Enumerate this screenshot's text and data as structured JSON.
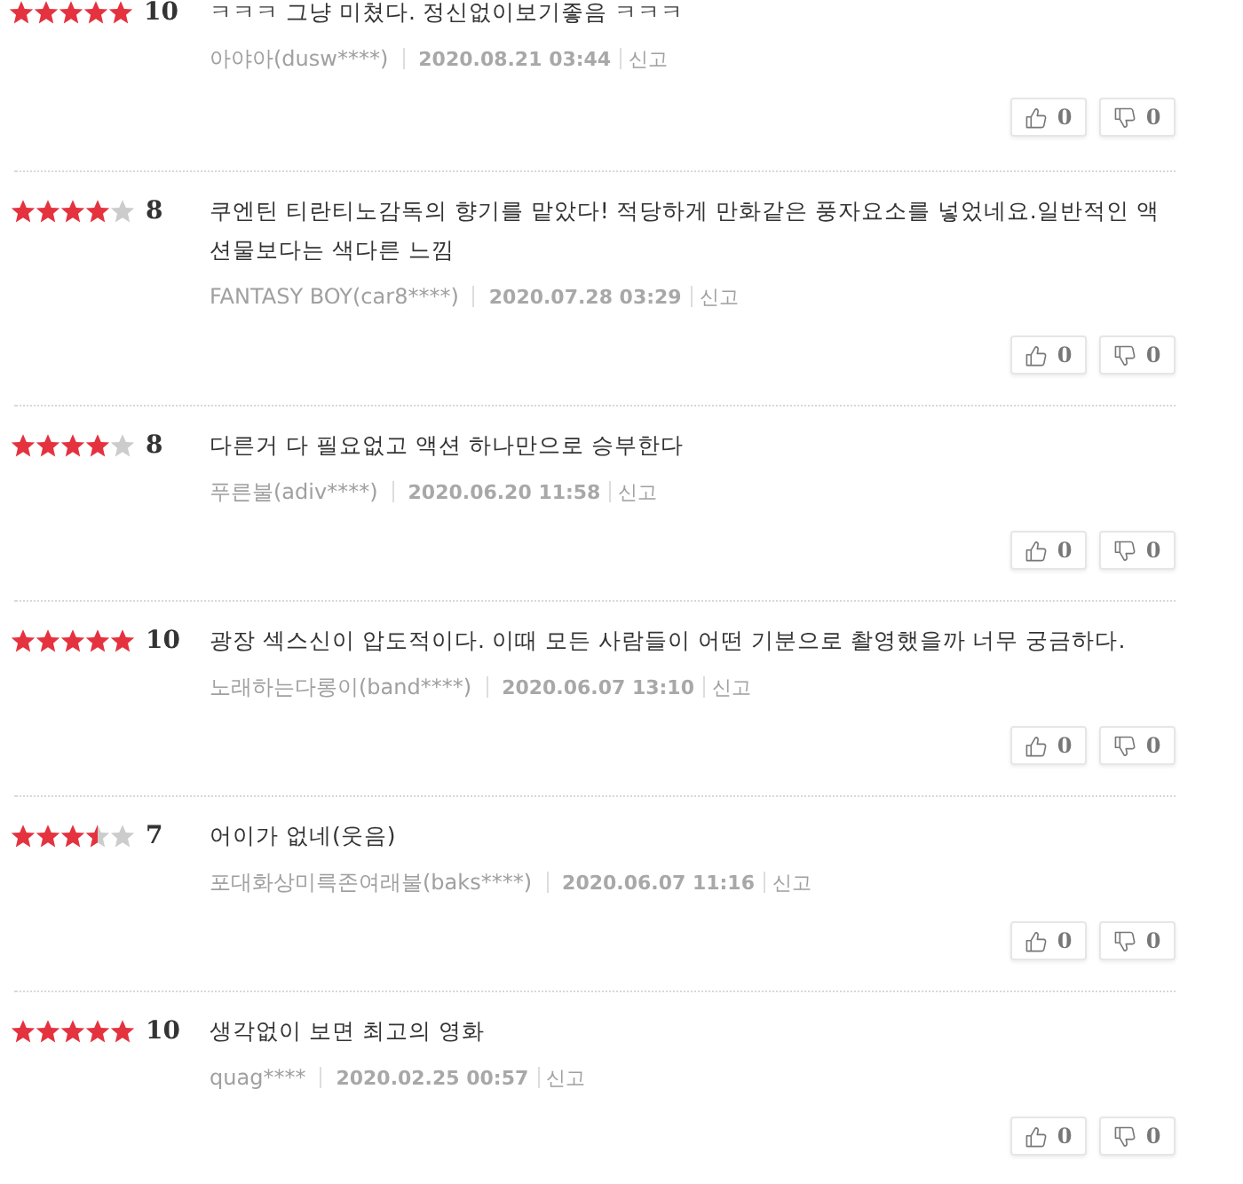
{
  "reviews": [
    {
      "stars": 5,
      "score": "10",
      "comment": "ㅋㅋㅋ 그냥 미쳤다. 정신없이보기좋음 ㅋㅋㅋ",
      "user": "아야아(dusw****)",
      "date": "2020.08.21 03:44",
      "report": "신고",
      "likes": "0",
      "dislikes": "0"
    },
    {
      "stars": 4,
      "score": "8",
      "comment": "쿠엔틴 티란티노감독의 향기를 맡았다! 적당하게 만화같은 풍자요소를 넣었네요.일반적인 액션물보다는 색다른 느낌",
      "user": "FANTASY BOY(car8****)",
      "date": "2020.07.28 03:29",
      "report": "신고",
      "likes": "0",
      "dislikes": "0"
    },
    {
      "stars": 4,
      "score": "8",
      "comment": "다른거 다 필요없고 액션 하나만으로 승부한다",
      "user": "푸른불(adiv****)",
      "date": "2020.06.20 11:58",
      "report": "신고",
      "likes": "0",
      "dislikes": "0"
    },
    {
      "stars": 5,
      "score": "10",
      "comment": "광장 섹스신이 압도적이다. 이때 모든 사람들이 어떤 기분으로 촬영했을까 너무 궁금하다.",
      "user": "노래하는다롱이(band****)",
      "date": "2020.06.07 13:10",
      "report": "신고",
      "likes": "0",
      "dislikes": "0"
    },
    {
      "stars": 3.5,
      "score": "7",
      "comment": "어이가 없네(웃음)",
      "user": "포대화상미륵존여래불(baks****)",
      "date": "2020.06.07 11:16",
      "report": "신고",
      "likes": "0",
      "dislikes": "0"
    },
    {
      "stars": 5,
      "score": "10",
      "comment": "생각없이 보면 최고의 영화",
      "user": "quag****",
      "date": "2020.02.25 00:57",
      "report": "신고",
      "likes": "0",
      "dislikes": "0"
    }
  ]
}
